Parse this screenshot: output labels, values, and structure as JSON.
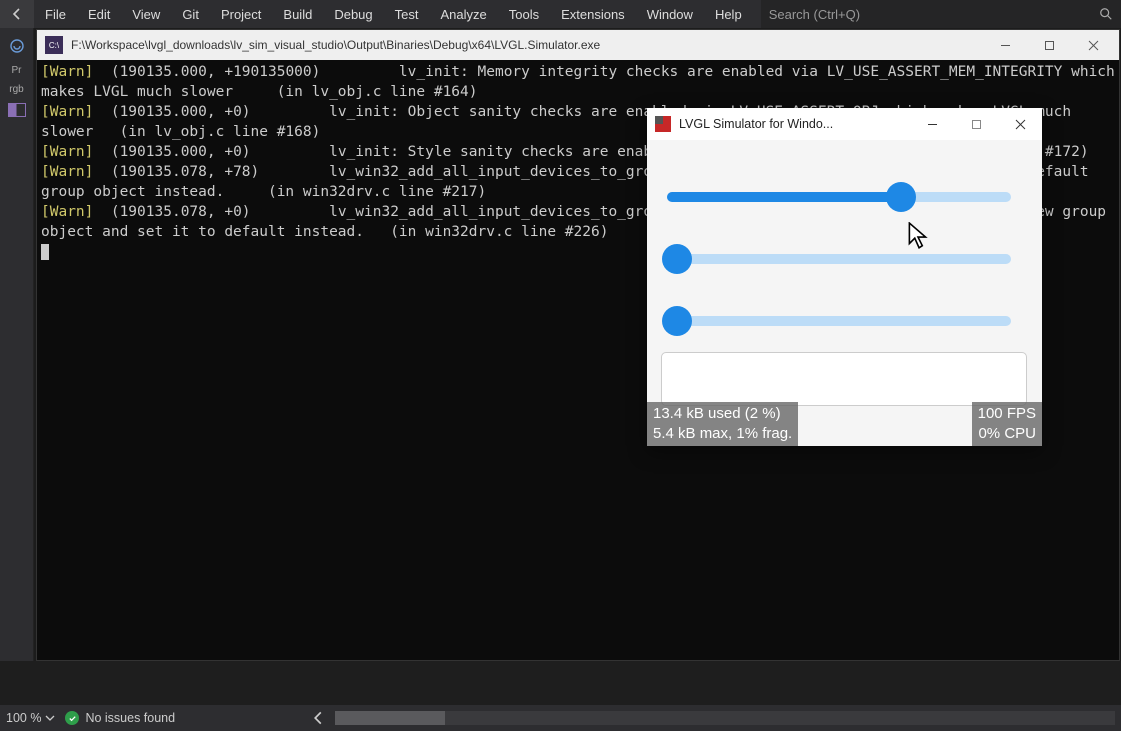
{
  "menubar": {
    "items": [
      "File",
      "Edit",
      "View",
      "Git",
      "Project",
      "Build",
      "Debug",
      "Test",
      "Analyze",
      "Tools",
      "Extensions",
      "Window",
      "Help"
    ],
    "search_placeholder": "Search (Ctrl+Q)"
  },
  "gutter": {
    "items": [
      "Pr",
      "rgb",
      ""
    ]
  },
  "console": {
    "title": "F:\\Workspace\\lvgl_downloads\\lv_sim_visual_studio\\Output\\Binaries\\Debug\\x64\\LVGL.Simulator.exe",
    "lines": [
      "[Warn]  (190135.000, +190135000)         lv_init: Memory integrity checks are enabled via LV_USE_ASSERT_MEM_INTEGRITY which makes LVGL much slower     (in lv_obj.c line #164)",
      "[Warn]  (190135.000, +0)         lv_init: Object sanity checks are enabled via LV_USE_ASSERT_OBJ which makes LVGL much slower   (in lv_obj.c line #168)",
      "[Warn]  (190135.000, +0)         lv_init: Style sanity checks are enabled that uses more RAM     (in lv_obj.c line #172)",
      "[Warn]  (190135.078, +78)        lv_win32_add_all_input_devices_to_group: The default group is not set. Create a default group object instead.     (in win32drv.c line #217)",
      "[Warn]  (190135.078, +0)         lv_win32_add_all_input_devices_to_group: Cannot get the default group. Create a new group object and set it to default instead.   (in win32drv.c line #226)"
    ]
  },
  "sim": {
    "title": "LVGL Simulator for Windo...",
    "sliders": [
      {
        "value_pct": 68
      },
      {
        "value_pct": 0
      },
      {
        "value_pct": 0
      }
    ],
    "hud_left_lines": [
      "13.4 kB used (2 %)",
      "5.4 kB max, 1% frag."
    ],
    "hud_right_lines": [
      "100 FPS",
      "0% CPU"
    ]
  },
  "status": {
    "zoom": "100 %",
    "issues": "No issues found"
  }
}
